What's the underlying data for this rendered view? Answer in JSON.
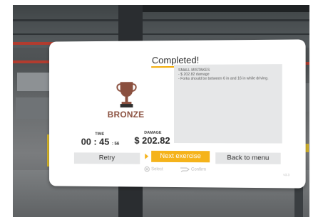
{
  "panel": {
    "title": "Completed!",
    "notes": {
      "heading": "SMALL MISTAKES",
      "lines": [
        "- $ 202.82 damage",
        "- Forks should be between 6 in and 16 in while driving."
      ]
    },
    "medal": "BRONZE",
    "stats": {
      "time_label": "TIME",
      "time_main": "00 : 45",
      "time_fraction": ": 56",
      "damage_label": "DAMAGE",
      "damage_value": "$ 202.82"
    },
    "buttons": {
      "retry": "Retry",
      "next": "Next exercise",
      "back": "Back to menu"
    },
    "hints": {
      "select": "Select",
      "confirm": "Confirm"
    },
    "version": "v3.3"
  },
  "colors": {
    "accent": "#f5b31b",
    "medal": "#8a4f3e"
  }
}
